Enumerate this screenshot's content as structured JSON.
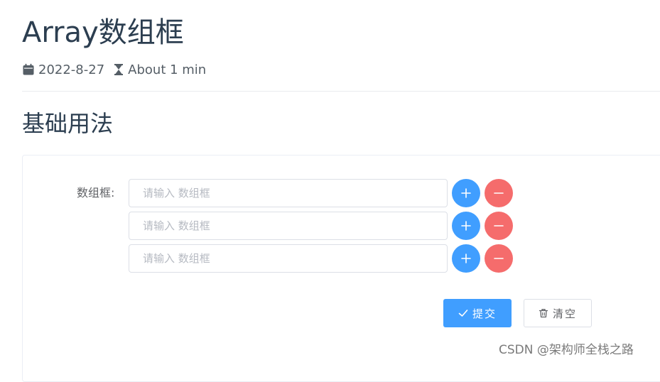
{
  "page": {
    "title": "Array数组框",
    "date": "2022-8-27",
    "reading_time": "About 1 min",
    "section_title": "基础用法"
  },
  "form": {
    "label": "数组框:",
    "rows": [
      {
        "value": "",
        "placeholder": "请输入 数组框"
      },
      {
        "value": "",
        "placeholder": "请输入 数组框"
      },
      {
        "value": "",
        "placeholder": "请输入 数组框"
      }
    ],
    "submit_label": "提交",
    "clear_label": "清空"
  },
  "watermark": "CSDN @架构师全栈之路",
  "icons": {
    "date": "calendar-icon",
    "reading_time": "hourglass-icon",
    "add_row": "plus-icon",
    "remove_row": "minus-icon",
    "submit": "check-icon",
    "clear": "trash-icon"
  },
  "colors": {
    "primary": "#409eff",
    "danger": "#f56c6c",
    "text": "#2c3e50",
    "placeholder": "#b6bac2",
    "border": "#dcdfe6"
  }
}
